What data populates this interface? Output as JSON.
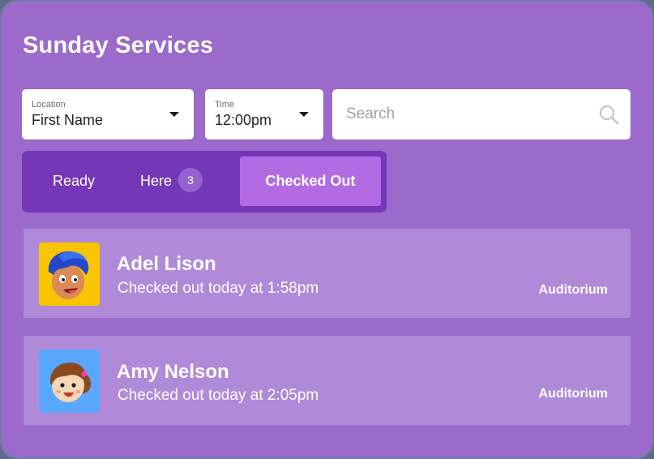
{
  "page": {
    "title": "Sunday Services"
  },
  "filters": {
    "location": {
      "label": "Location",
      "value": "First Name"
    },
    "time": {
      "label": "Time",
      "value": "12:00pm"
    }
  },
  "search": {
    "placeholder": "Search"
  },
  "tabs": [
    {
      "label": "Ready"
    },
    {
      "label": "Here",
      "badge": "3"
    },
    {
      "label": "Checked Out",
      "active": true
    }
  ],
  "people": [
    {
      "name": "Adel Lison",
      "status": "Checked out today at 1:58pm",
      "room": "Auditorium",
      "avatar_color": "#f9c400"
    },
    {
      "name": "Amy Nelson",
      "status": "Checked out today at 2:05pm",
      "room": "Auditorium",
      "avatar_color": "#5aa7ff"
    }
  ],
  "colors": {
    "background": "#9b6acb",
    "tab_bar": "#7437b8",
    "active_tab": "#b26be3",
    "row": "#b08ad8"
  }
}
